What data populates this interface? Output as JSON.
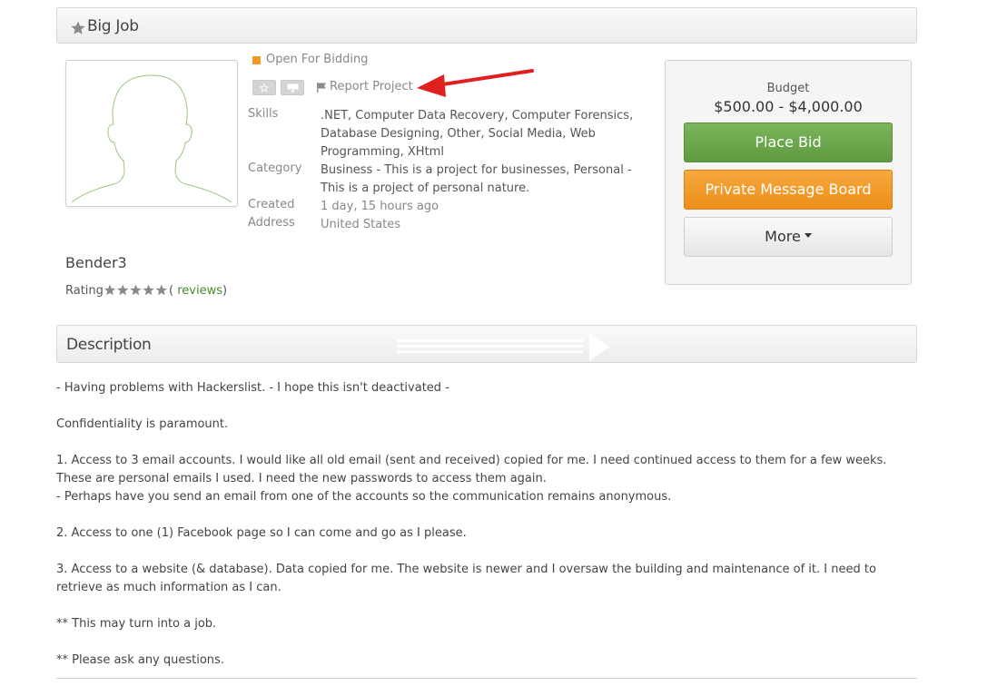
{
  "project": {
    "title": "Big Job",
    "status": "Open For Bidding",
    "report_label": "Report Project"
  },
  "meta": {
    "skills_label": "Skills",
    "skills_value": ".NET, Computer Data Recovery, Computer Forensics, Database Designing, Other, Social Media, Web Programming, XHtml",
    "category_label": "Category",
    "category_value": "Business - This is a project for businesses, Personal - This is a project of personal nature.",
    "created_label": "Created",
    "created_value": "1 day, 15 hours ago",
    "address_label": "Address",
    "address_value": "United States"
  },
  "owner": {
    "username": "Bender3",
    "rating_label": "Rating",
    "rating_stars": 5,
    "reviews_open": "(",
    "reviews_link": " reviews",
    "reviews_close": ")"
  },
  "budget": {
    "label": "Budget",
    "value": "$500.00 - $4,000.00",
    "place_bid": "Place Bid",
    "message_board": "Private Message Board",
    "more": "More"
  },
  "description": {
    "heading": "Description",
    "lines": [
      "- Having problems with Hackerslist. - I hope this isn't deactivated -",
      "",
      "Confidentiality is paramount.",
      "",
      "1. Access to 3 email accounts. I would like all old email (sent and received) copied for me. I need continued access to them for a few weeks. These are personal emails I used. I need the new passwords to access them again.",
      "- Perhaps have you send an email from one of the accounts so the communication remains anonymous.",
      "",
      "2. Access to one (1) Facebook page so I can come and go as I please.",
      "",
      "3. Access to a website (& database). Data copied for me. The website is newer and I oversaw the building and maintenance of it. I need to retrieve as much information as I can.",
      "",
      "** This may turn into a job.",
      "",
      "** Please ask any questions."
    ]
  },
  "colors": {
    "status_dot": "#f09a24",
    "place_bid": "#6aa84f",
    "message_board": "#f0961f",
    "annotation_arrow": "#e02020",
    "reviews_link": "#4a8a2c"
  }
}
